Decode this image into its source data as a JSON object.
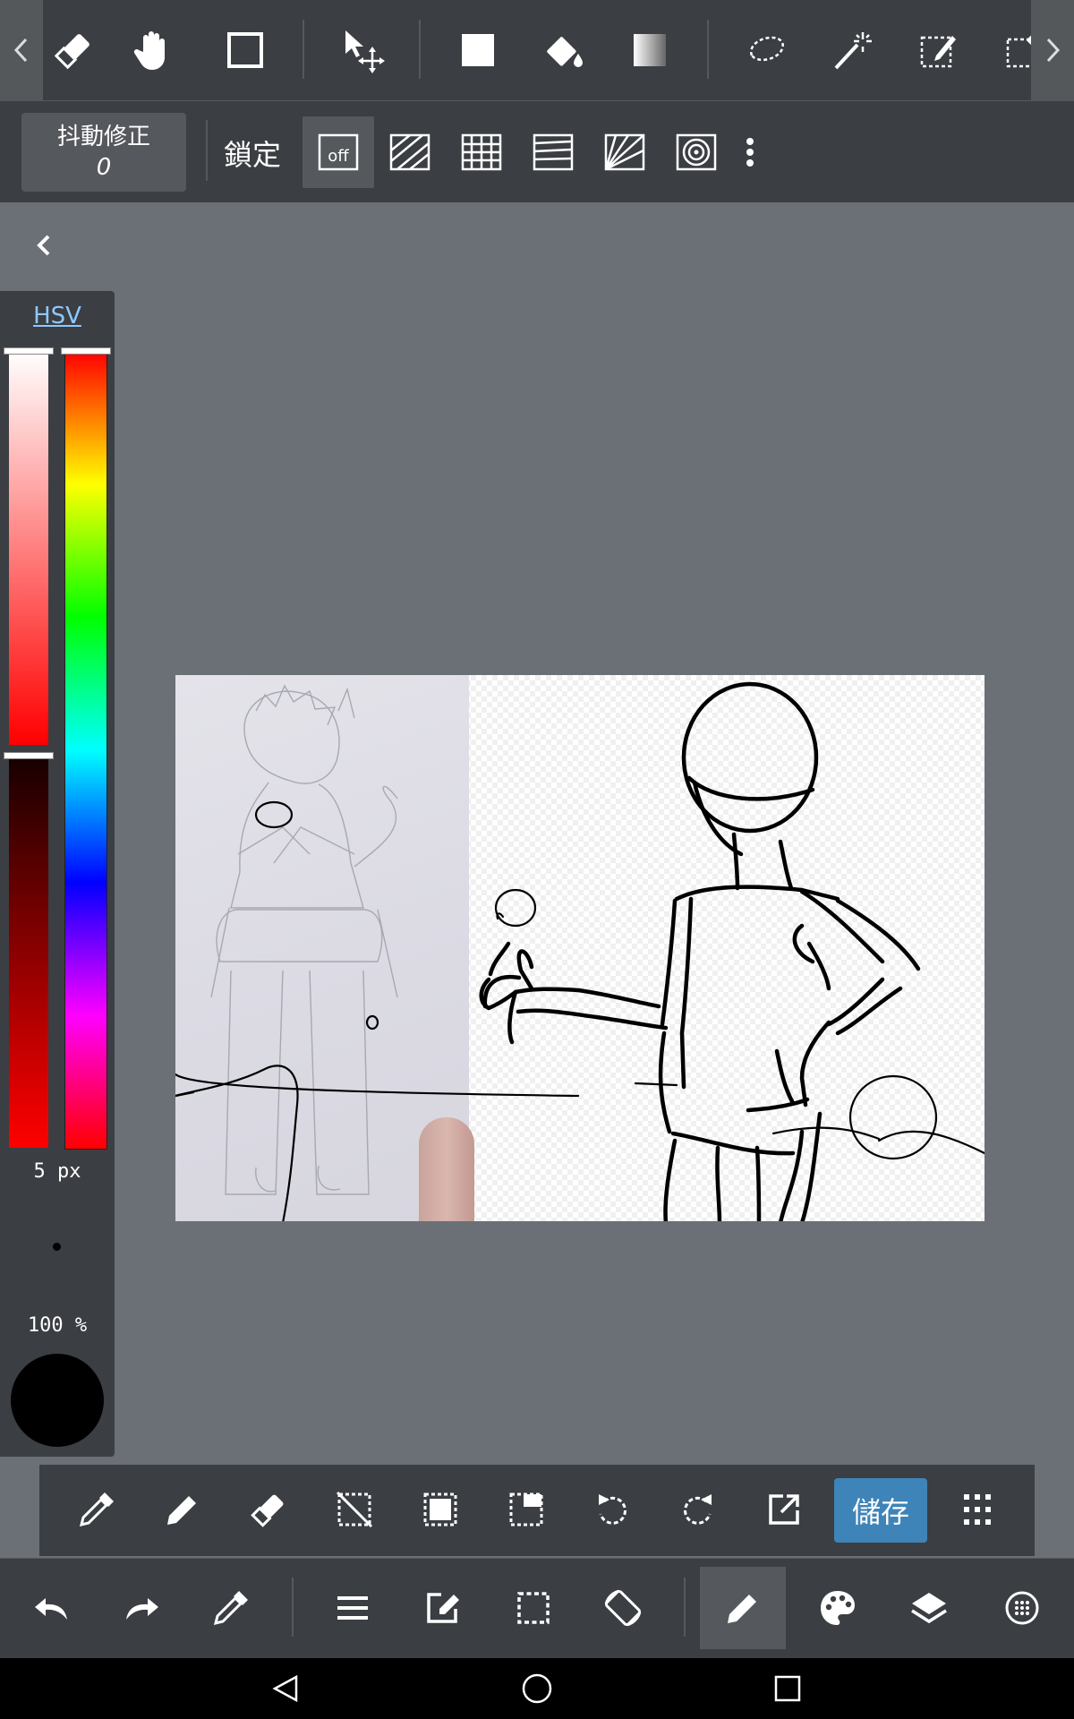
{
  "top_toolbar": {
    "tools": [
      "eraser-tool",
      "hand-tool",
      "rectangle-tool",
      "move-tool",
      "fill-rect-tool",
      "bucket-tool",
      "gradient-tool",
      "lasso-select-tool",
      "magic-wand-tool",
      "select-pen-tool",
      "select-eraser-tool"
    ]
  },
  "sub_toolbar": {
    "stabilizer_label": "抖動修正",
    "stabilizer_value": "0",
    "lock_label": "鎖定",
    "off_label": "off"
  },
  "color_panel": {
    "mode_label": "HSV",
    "brush_size": "5 px",
    "opacity": "100 %",
    "current_color": "#000000"
  },
  "action_bar": {
    "save_label": "儲存"
  },
  "colors": {
    "toolbar_bg": "#3b3e42",
    "workspace_bg": "#6b7076",
    "accent": "#3e84b8",
    "hsv_link": "#8ec8ff"
  }
}
